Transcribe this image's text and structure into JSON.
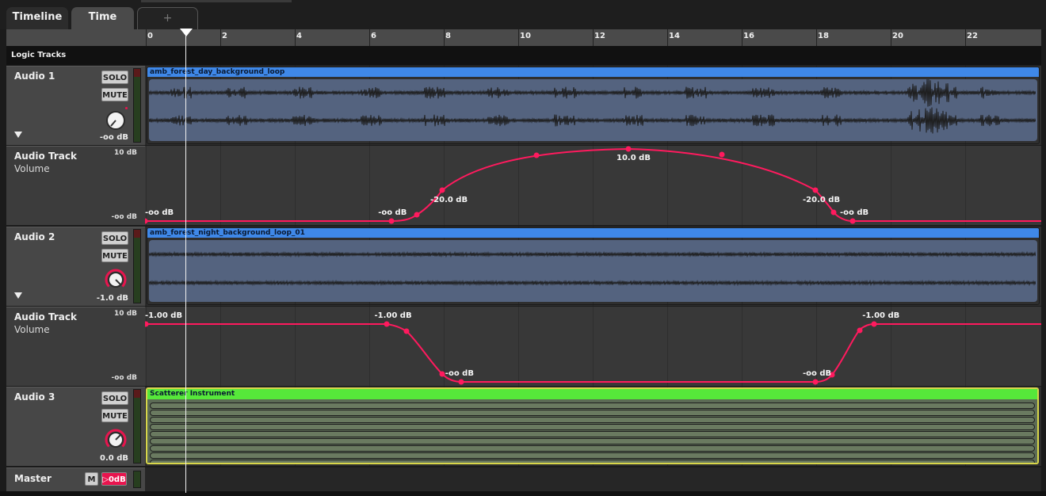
{
  "tabs": [
    {
      "label": "Timeline"
    },
    {
      "label": "Time"
    },
    {
      "label": "+"
    }
  ],
  "ruler": {
    "ticks": [
      "0",
      "2",
      "4",
      "6",
      "8",
      "10",
      "12",
      "14",
      "16",
      "18",
      "20",
      "22"
    ]
  },
  "logic_tracks_label": "Logic Tracks",
  "buttons": {
    "solo": "SOLO",
    "mute": "MUTE",
    "master_mute": "M",
    "master_db": "▷0dB"
  },
  "tracks": [
    {
      "name": "Audio 1",
      "db": "-oo dB",
      "knob_level": 0.0,
      "clip": {
        "title": "amb_forest_day_background_loop",
        "color": "#3f88e8"
      },
      "automation": {
        "name": "Audio Track",
        "param": "Volume",
        "max": "10 dB",
        "min": "-oo dB",
        "labels": [
          {
            "text": "-oo dB",
            "time": 0.0
          },
          {
            "text": "-oo dB",
            "time": 6.6
          },
          {
            "text": "-20.0 dB",
            "time": 8.0
          },
          {
            "text": "10.0 dB",
            "time": 13.0
          },
          {
            "text": "-20.0 dB",
            "time": 18.0
          },
          {
            "text": "-oo dB",
            "time": 19.0
          }
        ]
      }
    },
    {
      "name": "Audio 2",
      "db": "-1.0 dB",
      "knob_level": 0.95,
      "clip": {
        "title": "amb_forest_night_background_loop_01",
        "color": "#3f88e8"
      },
      "automation": {
        "name": "Audio Track",
        "param": "Volume",
        "max": "10 dB",
        "min": "-oo dB",
        "labels": [
          {
            "text": "-1.00 dB",
            "time": 0.0
          },
          {
            "text": "-1.00 dB",
            "time": 6.5
          },
          {
            "text": "-oo dB",
            "time": 8.4
          },
          {
            "text": "-oo dB",
            "time": 18.0
          },
          {
            "text": "-1.00 dB",
            "time": 19.6
          }
        ]
      }
    },
    {
      "name": "Audio 3",
      "db": "0.0 dB",
      "knob_level": 1.0,
      "clip": {
        "title": "Scatterer Instrument",
        "color": "#56e83a"
      }
    }
  ],
  "master": {
    "name": "Master"
  },
  "colors": {
    "automation": "#ff1a5e",
    "audio_clip_body": "#54637f",
    "instrument_clip_body": "#6a7a60",
    "accent_knob": "#e8144e"
  }
}
